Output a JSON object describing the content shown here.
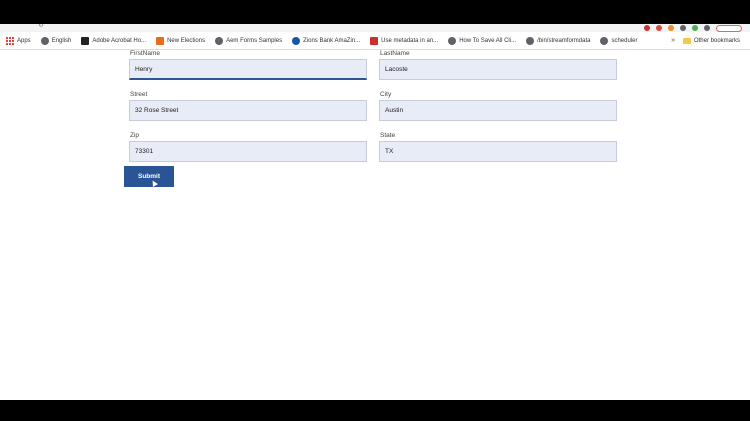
{
  "bookmarks": [
    {
      "label": "Apps",
      "icon": "apps-grid-icon"
    },
    {
      "label": "English",
      "icon": "globe-icon"
    },
    {
      "label": "Adobe Acrobat Ho...",
      "icon": "adobe-icon"
    },
    {
      "label": "New Elections",
      "icon": "elections-icon"
    },
    {
      "label": "Aem Forms Samples",
      "icon": "globe-icon"
    },
    {
      "label": "Zions Bank AmaZin...",
      "icon": "zions-icon"
    },
    {
      "label": "Use metadata in an...",
      "icon": "red-square-icon"
    },
    {
      "label": "How To Save All Cli...",
      "icon": "globe-icon"
    },
    {
      "label": "/bin/streamformdata",
      "icon": "globe-icon"
    },
    {
      "label": "scheduler",
      "icon": "globe-icon"
    }
  ],
  "bookmarks_more": "»",
  "other_bookmarks": "Other bookmarks",
  "form": {
    "firstname": {
      "label": "FirstName",
      "value": "Henry"
    },
    "lastname": {
      "label": "LastName",
      "value": "Lacoste"
    },
    "street": {
      "label": "Street",
      "value": "32 Rose Street"
    },
    "city": {
      "label": "City",
      "value": "Austin"
    },
    "zip": {
      "label": "Zip",
      "value": "73301"
    },
    "state": {
      "label": "State",
      "value": "TX"
    },
    "submit_label": "Submit"
  },
  "colors": {
    "primary": "#2a5595",
    "input_bg": "#e8ecf6"
  }
}
